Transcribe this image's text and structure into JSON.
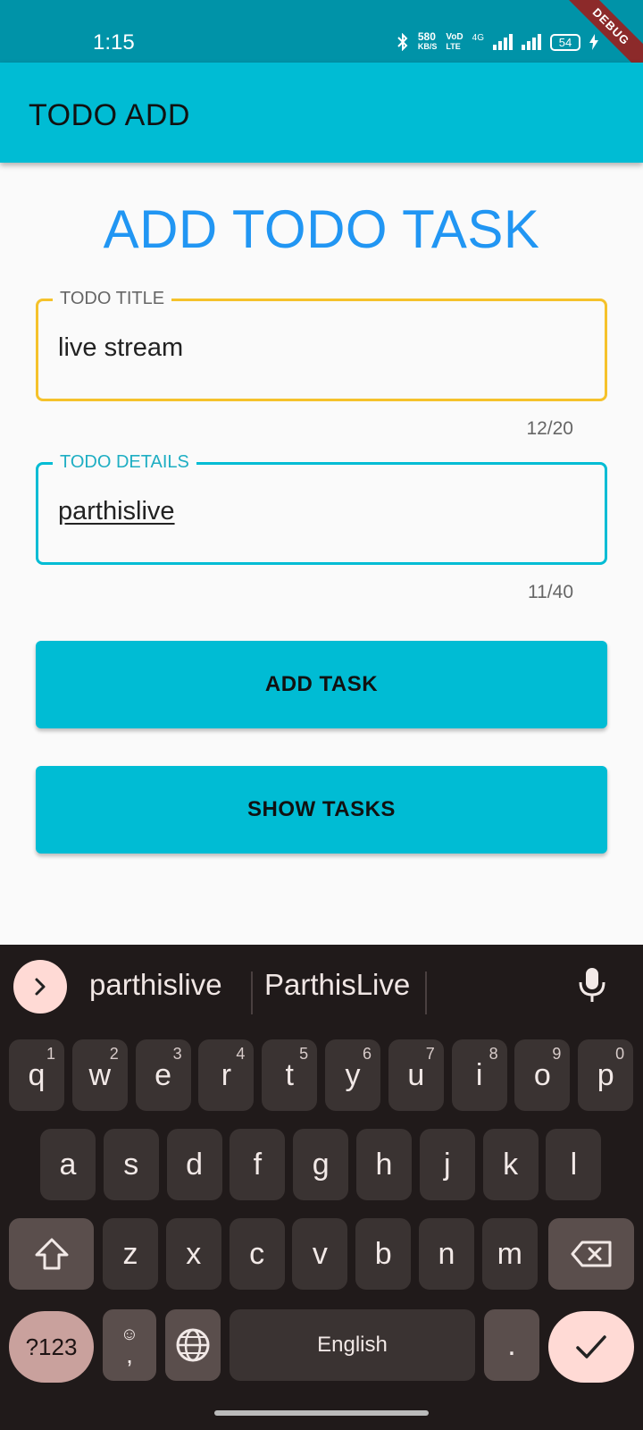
{
  "status_bar": {
    "time": "1:15",
    "net_speed_top": "580",
    "net_speed_bottom": "KB/S",
    "volte_top": "VoD",
    "volte_bottom": "LTE",
    "network_type": "4G",
    "battery": "54",
    "debug_banner": "DEBUG"
  },
  "app_bar": {
    "title": "TODO ADD"
  },
  "main": {
    "heading": "ADD TODO TASK",
    "title_field": {
      "label": "TODO TITLE",
      "value": "live stream",
      "counter": "12/20"
    },
    "details_field": {
      "label": "TODO DETAILS",
      "value": "parthislive",
      "counter": "11/40"
    },
    "add_button": "ADD TASK",
    "show_button": "SHOW TASKS"
  },
  "keyboard": {
    "suggestions": [
      "parthislive",
      "ParthisLive"
    ],
    "row1": [
      {
        "k": "q",
        "h": "1"
      },
      {
        "k": "w",
        "h": "2"
      },
      {
        "k": "e",
        "h": "3"
      },
      {
        "k": "r",
        "h": "4"
      },
      {
        "k": "t",
        "h": "5"
      },
      {
        "k": "y",
        "h": "6"
      },
      {
        "k": "u",
        "h": "7"
      },
      {
        "k": "i",
        "h": "8"
      },
      {
        "k": "o",
        "h": "9"
      },
      {
        "k": "p",
        "h": "0"
      }
    ],
    "row2": [
      "a",
      "s",
      "d",
      "f",
      "g",
      "h",
      "j",
      "k",
      "l"
    ],
    "row3": [
      "z",
      "x",
      "c",
      "v",
      "b",
      "n",
      "m"
    ],
    "symbols_key": "?123",
    "comma_key": ",",
    "space_key": "English",
    "period_key": "."
  },
  "colors": {
    "status_bar": "#0093a8",
    "app_bar": "#00bcd4",
    "heading": "#2196f3",
    "title_border": "#f5c22b",
    "details_border": "#00bcd4",
    "keyboard_bg": "#201a1a"
  }
}
